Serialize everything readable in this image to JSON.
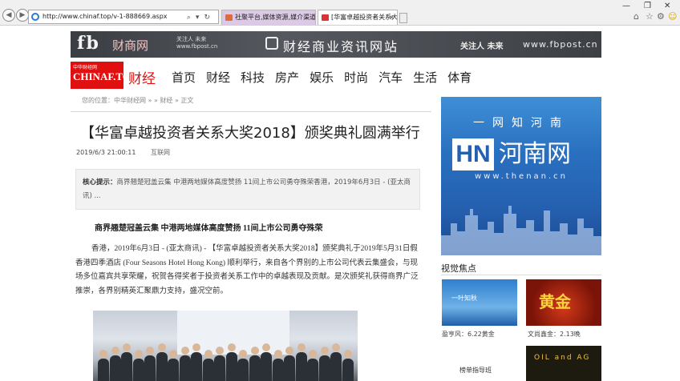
{
  "browser": {
    "url": "http://www.chinaf.top/v-1-888669.aspx",
    "tabs": [
      {
        "label": "社聚平台,媒体资源,媒介渠道_..."
      },
      {
        "label": "[华富卓越投资者关系大奖..."
      }
    ],
    "search_icon": "search-icon",
    "refresh_icon": "refresh-icon"
  },
  "banner": {
    "logo_text": "fb",
    "name": "财商网",
    "small_text": "关注人 未来\nwww.fbpost.cn",
    "title": "财经商业资讯网站",
    "slogan": "关注人 未来",
    "url": "www.fbpost.cn"
  },
  "site": {
    "logo_top": "中华财经网",
    "logo_main": "CHINAF.TOP",
    "section_title": "财经",
    "nav": [
      "首页",
      "财经",
      "科技",
      "房产",
      "娱乐",
      "时尚",
      "汽车",
      "生活",
      "体育"
    ]
  },
  "article": {
    "breadcrumb": "您的位置：中华财经网 » » 财经 » 正文",
    "title": "【华富卓越投资者关系大奖2018】颁奖典礼圆满举行",
    "date": "2019/6/3 21:00:11",
    "source": "互联网",
    "summary_label": "核心提示：",
    "summary_text": "商界翘楚冠盖云集 中港两地媒体高度赞扬 11间上市公司勇夺殊荣香港，2019年6月3日 - (亚太商讯) ...",
    "subhead": "商界翘楚冠盖云集 中港两地媒体高度赞扬 11间上市公司勇夺殊荣",
    "body": "香港，2019年6月3日 - (亚太商讯) - 【华富卓越投资者关系大奖2018】颁奖典礼于2019年5月31日假香港四季酒店 (Four Seasons Hotel Hong Kong) 顺利举行，来自各个界别的上市公司代表云集盛会，与现场多位嘉宾共享荣耀，祝贺各得奖者于投资者关系工作中的卓越表现及贡献。是次颁奖礼获得商界广泛推崇，各界别精英汇聚鼎力支持，盛况空前。"
  },
  "sidebar": {
    "ad_top": "一网知河南",
    "ad_logo": "HN",
    "ad_name": "河南网",
    "ad_url": "www.thenan.cn",
    "visual_title": "视觉焦点",
    "thumbs": [
      {
        "caption": "盈亨风：6.22黄金",
        "overlay": "一叶知秋"
      },
      {
        "caption": "文尚鑫金：2.13晚",
        "overlay": "黄金"
      },
      {
        "caption": "",
        "overlay": "OIL and AG"
      }
    ],
    "list_link": "榜单指导班"
  }
}
